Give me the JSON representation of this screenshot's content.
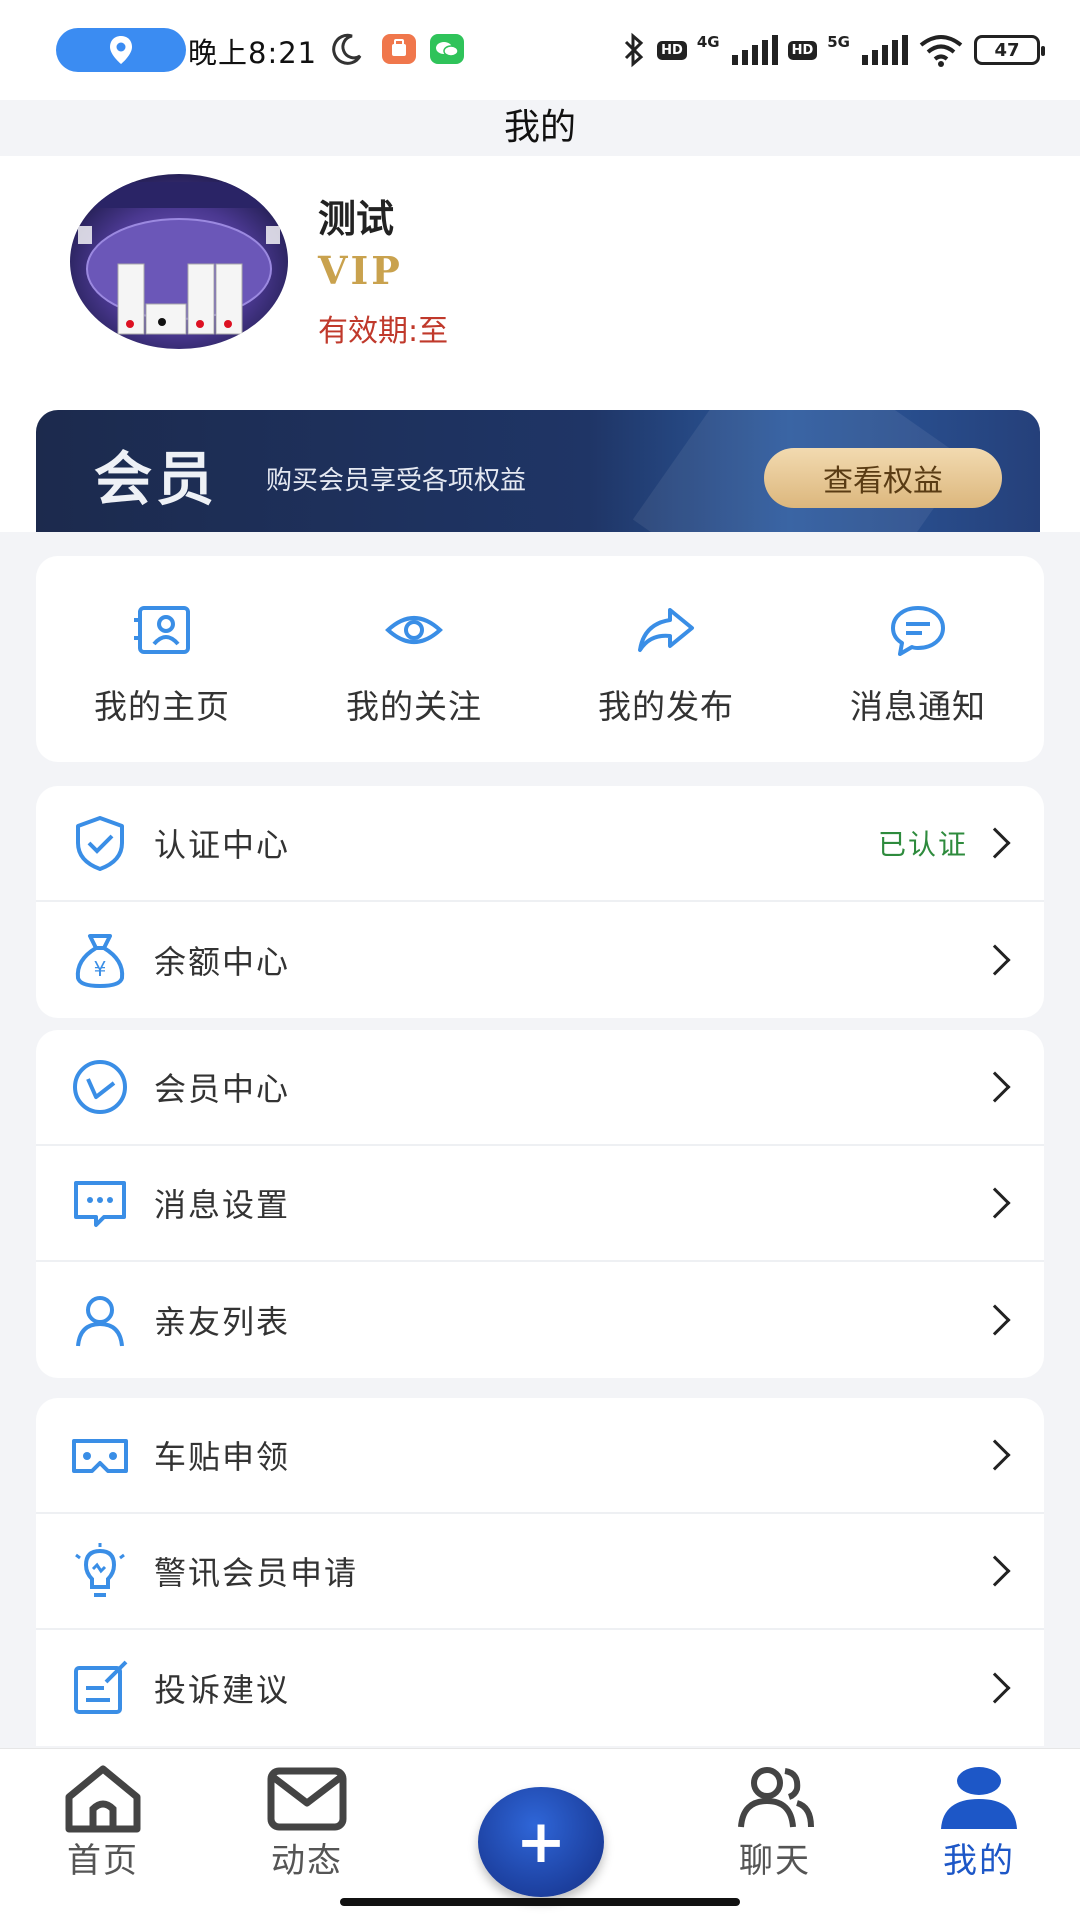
{
  "status_bar": {
    "time": "晚上8:21",
    "network_1": "4G",
    "network_2": "5G",
    "hd_label": "HD",
    "battery": "47"
  },
  "header": {
    "title": "我的"
  },
  "profile": {
    "name": "测试",
    "vip_label": "VIP",
    "validity": "有效期:至"
  },
  "vip_banner": {
    "title": "会员",
    "subtitle": "购买会员享受各项权益",
    "button": "查看权益"
  },
  "quick_actions": [
    {
      "label": "我的主页",
      "icon": "profile-card-icon"
    },
    {
      "label": "我的关注",
      "icon": "eye-icon"
    },
    {
      "label": "我的发布",
      "icon": "share-arrow-icon"
    },
    {
      "label": "消息通知",
      "icon": "chat-bubble-icon"
    }
  ],
  "menu_group_1": [
    {
      "label": "认证中心",
      "status": "已认证",
      "icon": "shield-check-icon"
    },
    {
      "label": "余额中心",
      "status": "",
      "icon": "money-bag-icon"
    }
  ],
  "menu_group_2": [
    {
      "label": "会员中心",
      "icon": "vip-circle-icon"
    },
    {
      "label": "消息设置",
      "icon": "message-settings-icon"
    },
    {
      "label": "亲友列表",
      "icon": "person-icon"
    }
  ],
  "menu_group_3": [
    {
      "label": "车贴申领",
      "icon": "vr-glasses-icon"
    },
    {
      "label": "警讯会员申请",
      "icon": "lightbulb-icon"
    },
    {
      "label": "投诉建议",
      "icon": "edit-note-icon"
    }
  ],
  "bottom_nav": {
    "items": [
      {
        "label": "首页",
        "icon": "home-icon"
      },
      {
        "label": "动态",
        "icon": "mail-icon"
      },
      {
        "label": "聊天",
        "icon": "people-icon"
      },
      {
        "label": "我的",
        "icon": "user-icon"
      }
    ],
    "active": "我的",
    "fab_symbol": "+"
  },
  "colors": {
    "accent": "#1d57c7",
    "icon_blue": "#3a8ee6",
    "verified_green": "#2e8b3d",
    "validity_red": "#c0392b",
    "vip_gold": "#c9a24e"
  }
}
